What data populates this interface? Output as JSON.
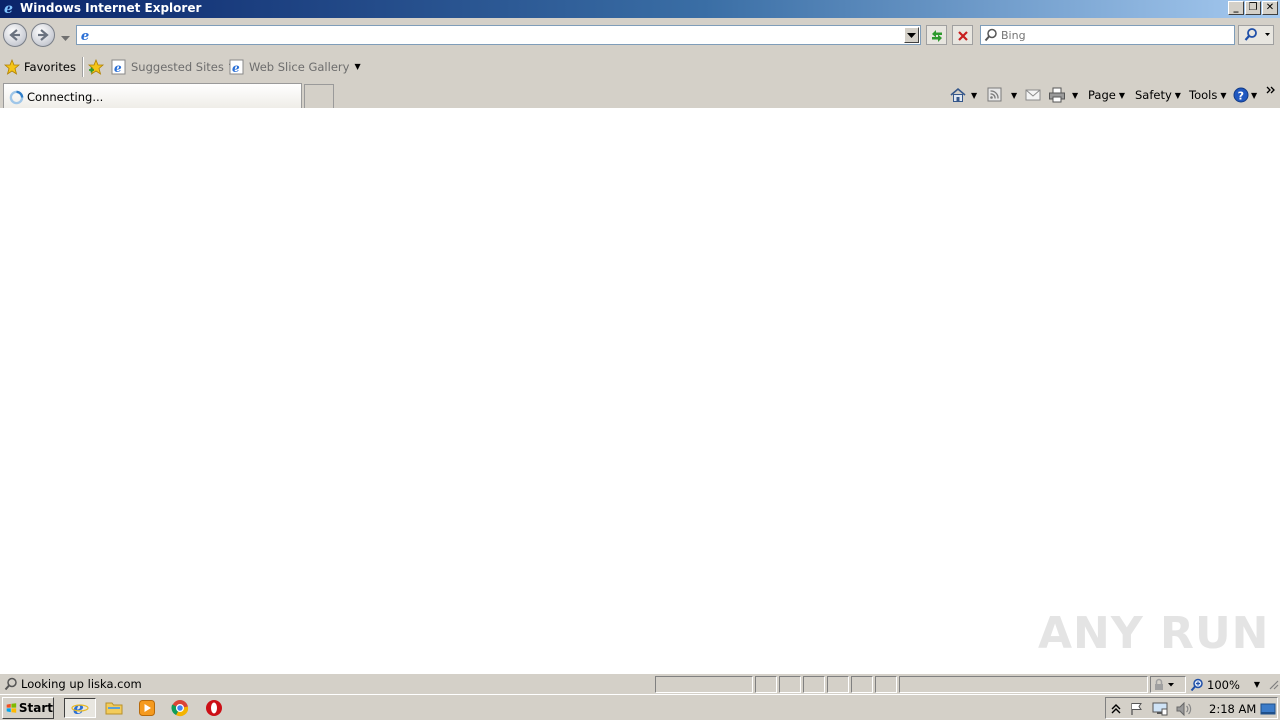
{
  "window": {
    "title": "Windows Internet Explorer"
  },
  "window_controls": {
    "minimize": "_",
    "restore": "❐",
    "close": "✕"
  },
  "navbar": {
    "address_value": "",
    "search_placeholder": "Bing"
  },
  "favorites_bar": {
    "favorites_label": "Favorites",
    "items": [
      {
        "label": "Suggested Sites"
      },
      {
        "label": "Web Slice Gallery"
      }
    ]
  },
  "tab": {
    "label": "Connecting..."
  },
  "command_bar": {
    "page": "Page",
    "safety": "Safety",
    "tools": "Tools"
  },
  "status": {
    "text": "Looking up liska.com",
    "zoom": "100%"
  },
  "taskbar": {
    "start_label": "Start",
    "clock": "2:18 AM"
  },
  "watermark": {
    "text": "ANY RUN"
  }
}
